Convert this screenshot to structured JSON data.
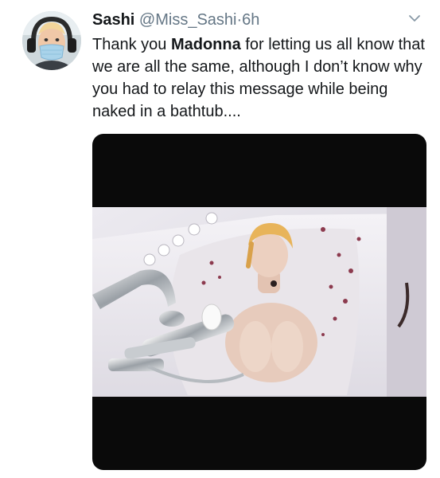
{
  "tweet": {
    "author_name": "Sashi",
    "handle": "@Miss_Sashi",
    "separator": "·",
    "time": "6h",
    "text_before": "Thank you ",
    "text_bold": "Madonna",
    "text_after": " for letting us all know that we are all the same, although I don’t know why you had to relay this message while being naked in a bathtub....",
    "menu_icon": "chevron-down-icon"
  },
  "colors": {
    "text": "#14171a",
    "secondary": "#657786",
    "media_bg": "#0a0a0a"
  }
}
